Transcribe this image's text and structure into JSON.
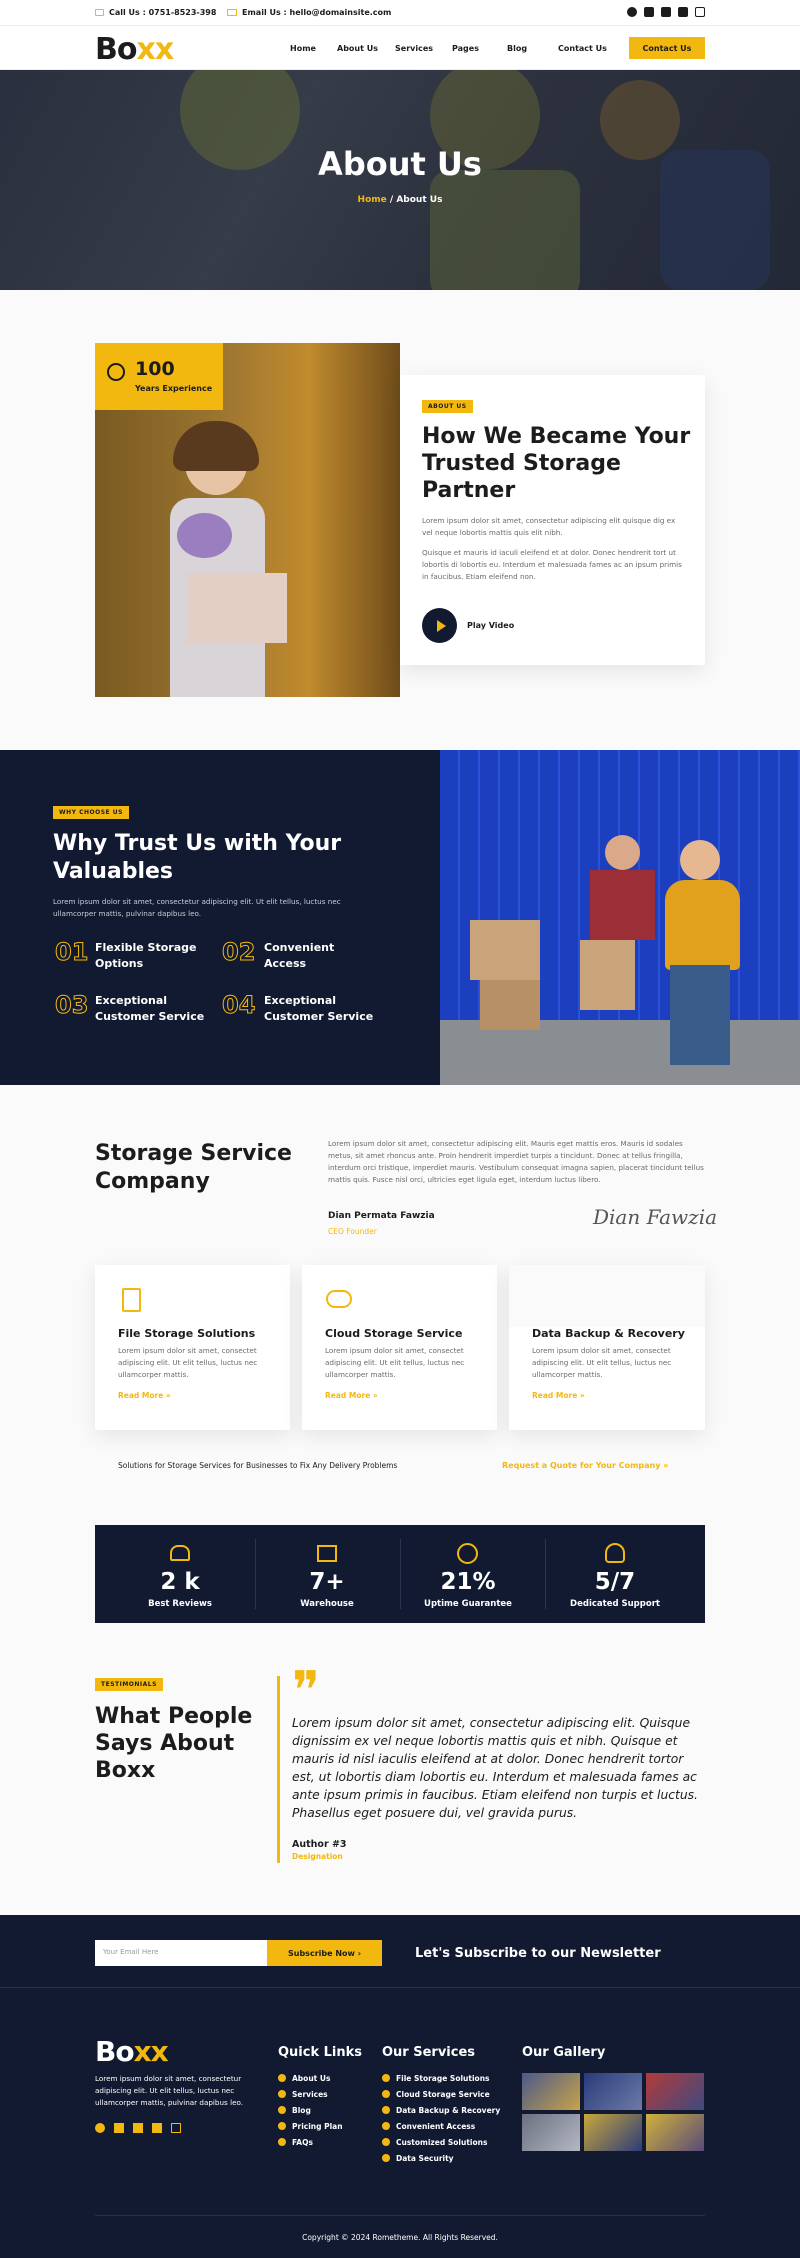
{
  "topbar": {
    "call": "Call Us : 0751-8523-398",
    "email": "Email Us : hello@domainsite.com"
  },
  "brand": {
    "prefix": "Bo",
    "suffix": "xx",
    "accent": "#f2b80f",
    "dark": "#111a30"
  },
  "nav": {
    "items": [
      "Home",
      "About Us",
      "Services",
      "Pages",
      "Blog",
      "Contact Us"
    ],
    "cta": "Contact Us"
  },
  "hero": {
    "title": "About Us",
    "crumb_home": "Home",
    "crumb_sep": "/",
    "crumb_current": "About Us"
  },
  "about": {
    "years_num": "100",
    "years_label": "Years Experience",
    "badge": "ABOUT US",
    "heading": "How We Became Your Trusted Storage Partner",
    "p1": "Lorem ipsum dolor sit amet, consectetur adipiscing elit quisque dig ex vel neque lobortis mattis quis elit nibh.",
    "p2": "Quisque et mauris id iaculi eleifend et at dolor. Donec hendrerit tort ut lobortis di lobortis eu. Interdum et malesuada fames ac an ipsum primis in faucibus. Etiam eleifend non.",
    "play": "Play Video"
  },
  "why": {
    "badge": "WHY CHOOSE US",
    "heading": "Why Trust Us with Your Valuables",
    "text": "Lorem ipsum dolor sit amet, consectetur adipiscing elit. Ut elit tellus, luctus nec ullamcorper mattis, pulvinar dapibus leo.",
    "features": [
      {
        "num": "01",
        "title": "Flexible Storage Options"
      },
      {
        "num": "02",
        "title": "Convenient Access"
      },
      {
        "num": "03",
        "title": "Exceptional Customer Service"
      },
      {
        "num": "04",
        "title": "Exceptional Customer Service"
      }
    ]
  },
  "company": {
    "heading": "Storage Service Company",
    "text": "Lorem ipsum dolor sit amet, consectetur adipiscing elit. Mauris eget mattis eros. Mauris id sodales metus, sit amet rhoncus ante. Proin hendrerit imperdiet turpis a tincidunt. Donec at tellus fringilla, interdum orci tristique, imperdiet mauris. Vestibulum consequat imagna sapien, placerat tincidunt tellus mattis quis. Fusce nisl orci, ultricies eget ligula eget, interdum luctus libero.",
    "name": "Dian Permata Fawzia",
    "role": "CEO Founder",
    "signature": "Dian Fawzia"
  },
  "services": [
    {
      "title": "File Storage Solutions",
      "text": "Lorem ipsum dolor sit amet, consectet adipiscing elit. Ut elit tellus, luctus nec ullamcorper mattis.",
      "more": "Read More"
    },
    {
      "title": "Cloud Storage Service",
      "text": "Lorem ipsum dolor sit amet, consectet adipiscing elit. Ut elit tellus, luctus nec ullamcorper mattis.",
      "more": "Read More"
    },
    {
      "title": "Data Backup & Recovery",
      "text": "Lorem ipsum dolor sit amet, consectet adipiscing elit. Ut elit tellus, luctus nec ullamcorper mattis.",
      "more": "Read More"
    }
  ],
  "solutions": {
    "text": "Solutions for Storage Services for Businesses to Fix Any Delivery Problems",
    "link": "Request a Quote for Your Company"
  },
  "stats": [
    {
      "num": "2 k",
      "label": "Best Reviews"
    },
    {
      "num": "7+",
      "label": "Warehouse"
    },
    {
      "num": "21%",
      "label": "Uptime Guarantee"
    },
    {
      "num": "5/7",
      "label": "Dedicated Support"
    }
  ],
  "testimonial": {
    "badge": "TESTIMONIALS",
    "heading": "What People Says About Boxx",
    "quote": "Lorem ipsum dolor sit amet, consectetur adipiscing elit. Quisque dignissim ex vel neque lobortis mattis quis et nibh. Quisque et mauris id nisl iaculis eleifend at at dolor. Donec hendrerit tortor est, ut lobortis diam lobortis eu. Interdum et malesuada fames ac ante ipsum primis in faucibus. Etiam eleifend non turpis et luctus. Phasellus eget posuere dui, vel gravida purus.",
    "author": "Author #3",
    "designation": "Designation"
  },
  "newsletter": {
    "placeholder": "Your Email Here",
    "button": "Subscribe Now",
    "heading": "Let's Subscribe to our Newsletter"
  },
  "footer": {
    "about": "Lorem ipsum dolor sit amet, consectetur adipiscing elit. Ut elit tellus, luctus nec ullamcorper mattis, pulvinar dapibus leo.",
    "quick_title": "Quick Links",
    "quick": [
      "About Us",
      "Services",
      "Blog",
      "Pricing Plan",
      "FAQs"
    ],
    "serv_title": "Our Services",
    "serv": [
      "File Storage Solutions",
      "Cloud Storage Service",
      "Data Backup & Recovery",
      "Convenient Access",
      "Customized Solutions",
      "Data Security"
    ],
    "gallery_title": "Our Gallery",
    "copyright": "Copyright © 2024 Rometheme. All Rights Reserved."
  }
}
